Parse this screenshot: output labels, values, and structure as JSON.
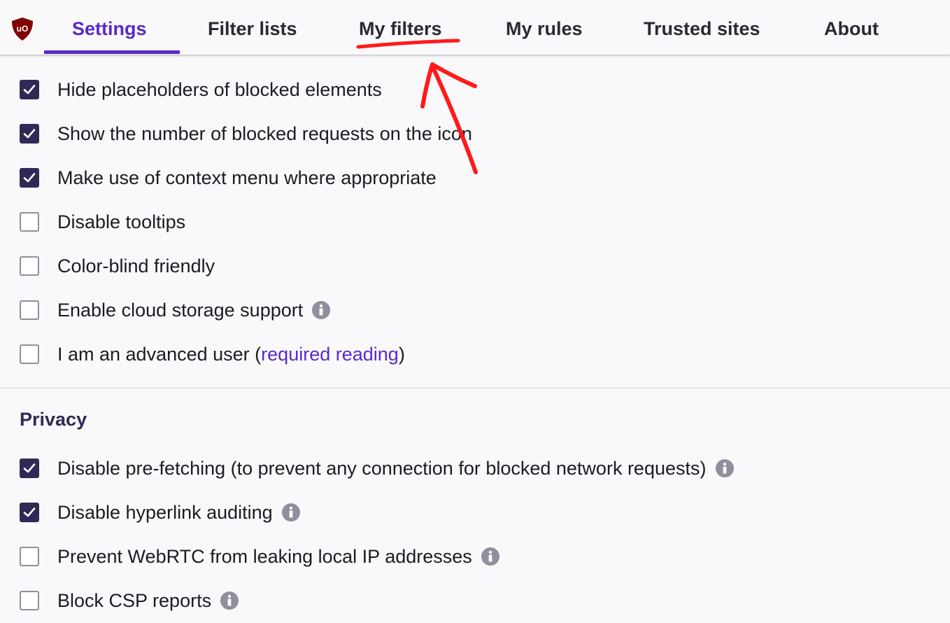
{
  "tabs": [
    {
      "label": "Settings",
      "active": true
    },
    {
      "label": "Filter lists",
      "active": false
    },
    {
      "label": "My filters",
      "active": false
    },
    {
      "label": "My rules",
      "active": false
    },
    {
      "label": "Trusted sites",
      "active": false
    },
    {
      "label": "About",
      "active": false
    }
  ],
  "logo": {
    "text": "uO",
    "color": "#800000"
  },
  "appearance": {
    "items": [
      {
        "label": "Hide placeholders of blocked elements",
        "checked": true
      },
      {
        "label": "Show the number of blocked requests on the icon",
        "checked": true
      },
      {
        "label": "Make use of context menu where appropriate",
        "checked": true
      },
      {
        "label": "Disable tooltips",
        "checked": false
      },
      {
        "label": "Color-blind friendly",
        "checked": false
      },
      {
        "label": "Enable cloud storage support",
        "checked": false,
        "info": true
      },
      {
        "label": "I am an advanced user (",
        "link": "required reading",
        "suffix": ")",
        "checked": false
      }
    ]
  },
  "privacy": {
    "heading": "Privacy",
    "items": [
      {
        "label": "Disable pre-fetching (to prevent any connection for blocked network requests)",
        "checked": true,
        "info": true
      },
      {
        "label": "Disable hyperlink auditing",
        "checked": true,
        "info": true
      },
      {
        "label": "Prevent WebRTC from leaking local IP addresses",
        "checked": false,
        "info": true
      },
      {
        "label": "Block CSP reports",
        "checked": false,
        "info": true
      }
    ]
  },
  "colors": {
    "accent": "#592acb",
    "checkbox_checked": "#2f2a55",
    "annotation": "#ff1a1a"
  },
  "icons": {
    "check": "check-icon",
    "info": "info-icon",
    "logo": "ublock-shield-icon"
  }
}
